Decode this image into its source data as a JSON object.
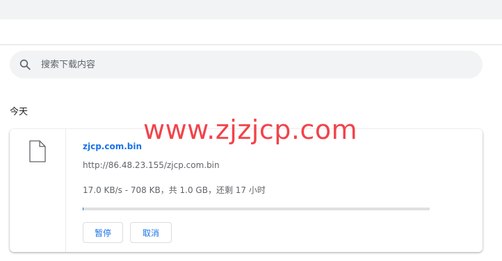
{
  "search": {
    "placeholder": "搜索下载内容",
    "icon": "search-icon"
  },
  "date_group": "今天",
  "download": {
    "file_icon": "file-icon",
    "file_name": "zjcp.com.bin",
    "url": "http://86.48.23.155/zjcp.com.bin",
    "status": "17.0 KB/s - 708 KB，共 1.0 GB，还剩 17 小时",
    "progress_fraction": 0.0007,
    "pause_label": "暂停",
    "cancel_label": "取消"
  },
  "watermark": "www.zjzjcp.com",
  "colors": {
    "accent": "#1a73e8",
    "watermark": "#f2434a",
    "strip": "#f1f3f4"
  }
}
